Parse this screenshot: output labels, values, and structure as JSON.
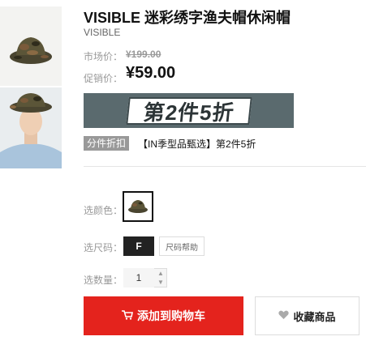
{
  "product": {
    "title": "VISIBLE 迷彩绣字渔夫帽休闲帽",
    "brand": "VISIBLE"
  },
  "price": {
    "market_label": "市场价：",
    "market_value": "¥199.00",
    "promo_label": "促销价：",
    "promo_value": "¥59.00"
  },
  "banner": {
    "text": "第2件5折"
  },
  "promotion": {
    "tag": "分件折扣",
    "description": "【IN季型品甄选】第2件5折"
  },
  "options": {
    "color_label": "选颜色：",
    "size_label": "选尺码：",
    "size_value": "F",
    "size_help": "尺码帮助",
    "qty_label": "选数量：",
    "qty_value": "1"
  },
  "actions": {
    "add_to_cart": "添加到购物车",
    "favorite": "收藏商品"
  },
  "colors": {
    "accent": "#e4231d",
    "camo_dark": "#3e3a26",
    "camo_brown": "#7a5a3a",
    "camo_green": "#5b6140"
  }
}
